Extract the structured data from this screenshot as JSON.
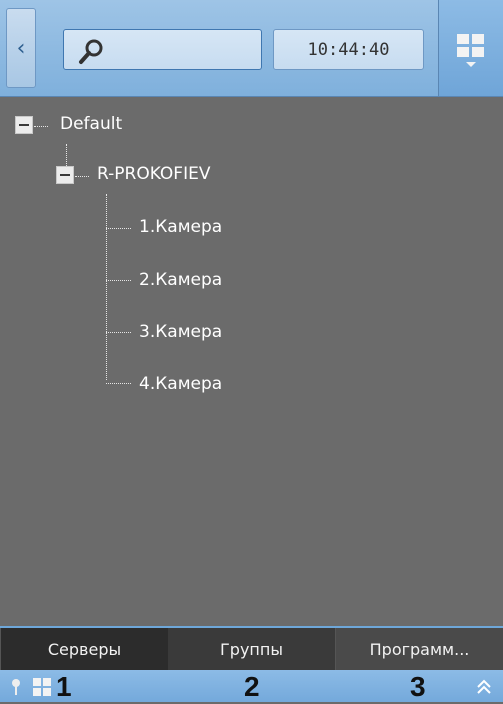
{
  "toolbar": {
    "back_icon": "chevron-left-icon",
    "search_placeholder": "",
    "search_icon": "search-icon",
    "time": "10:44:40",
    "layout_icon": "layout-grid-icon"
  },
  "tree": {
    "root": {
      "label": "Default"
    },
    "server": {
      "label": "R-PROKOFIEV"
    },
    "cameras": [
      {
        "label": "1.Камера"
      },
      {
        "label": "2.Камера"
      },
      {
        "label": "3.Камера"
      },
      {
        "label": "4.Камера"
      }
    ]
  },
  "tabs": [
    {
      "label": "Серверы"
    },
    {
      "label": "Группы"
    },
    {
      "label": "Программ..."
    }
  ],
  "statusbar": {
    "pages": [
      "1",
      "2",
      "3"
    ],
    "pin_icon": "pin-icon",
    "grid_icon": "grid-icon",
    "expand_icon": "double-chevron-up-icon"
  },
  "colors": {
    "accent": "#7fb0dc",
    "panel_bg": "#6b6b6b",
    "tab_bg": "#4a4a4a"
  }
}
